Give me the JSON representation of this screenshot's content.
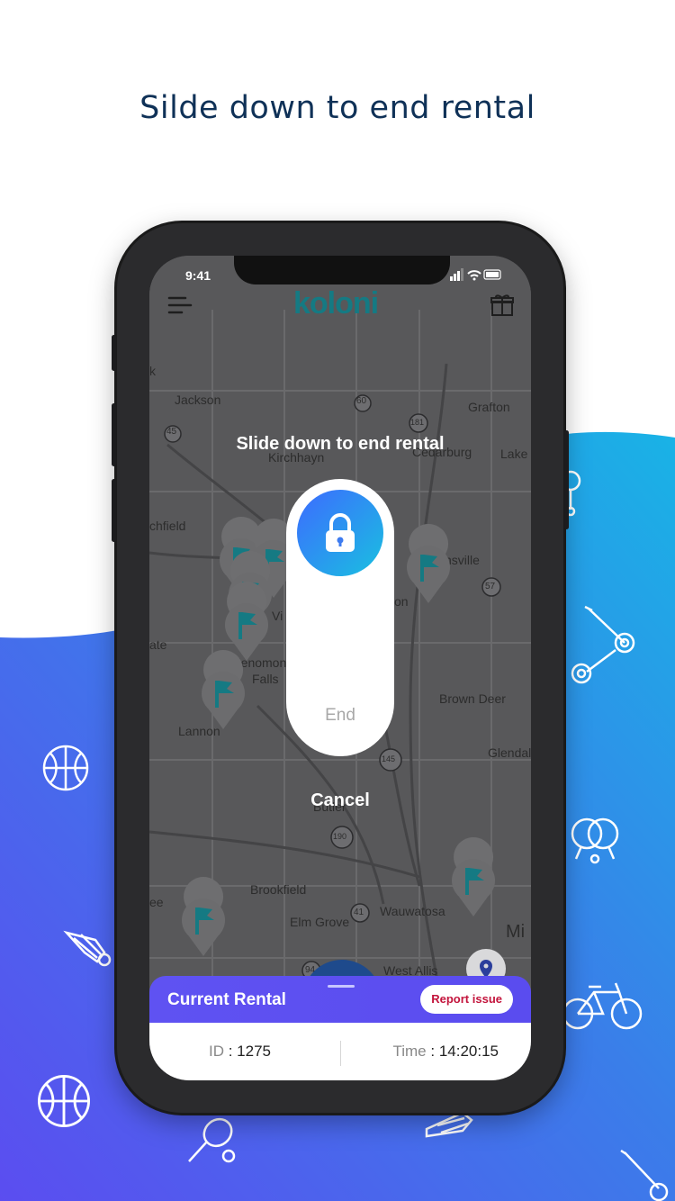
{
  "headline": "Silde down to end rental",
  "status": {
    "time": "9:41"
  },
  "app": {
    "logo": "koloni"
  },
  "map_labels": {
    "jackson": "Jackson",
    "kirchhayn": "Kirchhayn",
    "grafton": "Grafton",
    "cedarburg": "Cedarburg",
    "lake": "Lake",
    "richfield": "chfield",
    "mequon": "nsville",
    "on": "on",
    "menomonee": "Menomon",
    "falls": "Falls",
    "vi": "Vi",
    "ate": "ate",
    "brown_deer": "Brown Deer",
    "lannon": "Lannon",
    "glendale": "Glendal",
    "butler": "Butler",
    "brookfield": "Brookfield",
    "wauwatosa": "Wauwatosa",
    "elm_grove": "Elm Grove",
    "west_allis": "West Allis",
    "mil": "Mi",
    "ee": "ee",
    "k": "k",
    "hwy60": "60",
    "hwy45": "45",
    "hwy181": "181",
    "hwy57": "57",
    "hwy145": "145",
    "hwy190": "190",
    "hwy41": "41",
    "hwy94": "94"
  },
  "overlay": {
    "title": "Slide down to end rental",
    "end_label": "End",
    "cancel_label": "Cancel"
  },
  "rental": {
    "title": "Current Rental",
    "report_label": "Report issue",
    "id_label": "ID",
    "id_value": "1275",
    "time_label": "Time",
    "time_value": "14:20:15"
  },
  "colors": {
    "headline": "#0f3157",
    "gradient_start": "#5b4df0",
    "gradient_end": "#1aa6e4",
    "accent": "#157a83",
    "report": "#c3143c"
  },
  "icons": [
    "menu-icon",
    "gift-icon",
    "lock-icon",
    "location-pin-icon",
    "flag-marker-icon",
    "basketball-icon",
    "scooter-icon",
    "ping-pong-icon",
    "bicycle-icon",
    "shuttlecock-icon",
    "tennis-racket-icon"
  ]
}
